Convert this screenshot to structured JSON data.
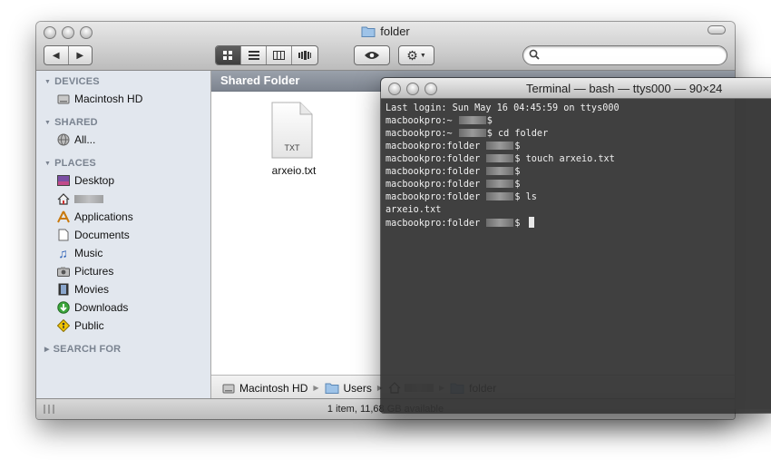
{
  "finder": {
    "window_title": "folder",
    "view_buttons": [
      "icon-view",
      "list-view",
      "column-view",
      "cover-flow-view"
    ],
    "sidebar": {
      "devices_heading": "DEVICES",
      "devices": [
        {
          "label": "Macintosh HD",
          "icon": "hard-drive-icon"
        }
      ],
      "shared_heading": "SHARED",
      "shared": [
        {
          "label": "All...",
          "icon": "network-icon"
        }
      ],
      "places_heading": "PLACES",
      "places": [
        {
          "label": "Desktop",
          "icon": "desktop-icon"
        },
        {
          "label": "",
          "icon": "home-icon"
        },
        {
          "label": "Applications",
          "icon": "applications-icon"
        },
        {
          "label": "Documents",
          "icon": "documents-icon"
        },
        {
          "label": "Music",
          "icon": "music-icon"
        },
        {
          "label": "Pictures",
          "icon": "pictures-icon"
        },
        {
          "label": "Movies",
          "icon": "movies-icon"
        },
        {
          "label": "Downloads",
          "icon": "downloads-icon"
        },
        {
          "label": "Public",
          "icon": "public-icon"
        }
      ],
      "search_heading": "SEARCH FOR"
    },
    "content_header": "Shared Folder",
    "files": [
      {
        "name": "arxeio.txt",
        "badge": "TXT"
      }
    ],
    "path": [
      "Macintosh HD",
      "Users",
      "",
      "folder"
    ],
    "status": "1 item, 11,68 GB available"
  },
  "terminal": {
    "title": "Terminal — bash — ttys000 — 90×24",
    "lines": [
      {
        "prefix": "Last login: Sun May 16 04:45:59 on ttys000",
        "mask": false,
        "suffix": ""
      },
      {
        "prefix": "macbookpro:~ ",
        "mask": true,
        "suffix": "$"
      },
      {
        "prefix": "macbookpro:~ ",
        "mask": true,
        "suffix": "$ cd folder"
      },
      {
        "prefix": "macbookpro:folder ",
        "mask": true,
        "suffix": "$"
      },
      {
        "prefix": "macbookpro:folder ",
        "mask": true,
        "suffix": "$ touch arxeio.txt"
      },
      {
        "prefix": "macbookpro:folder ",
        "mask": true,
        "suffix": "$"
      },
      {
        "prefix": "macbookpro:folder ",
        "mask": true,
        "suffix": "$"
      },
      {
        "prefix": "macbookpro:folder ",
        "mask": true,
        "suffix": "$ ls"
      },
      {
        "prefix": "arxeio.txt",
        "mask": false,
        "suffix": ""
      },
      {
        "prefix": "macbookpro:folder ",
        "mask": true,
        "suffix": "$ "
      }
    ]
  }
}
